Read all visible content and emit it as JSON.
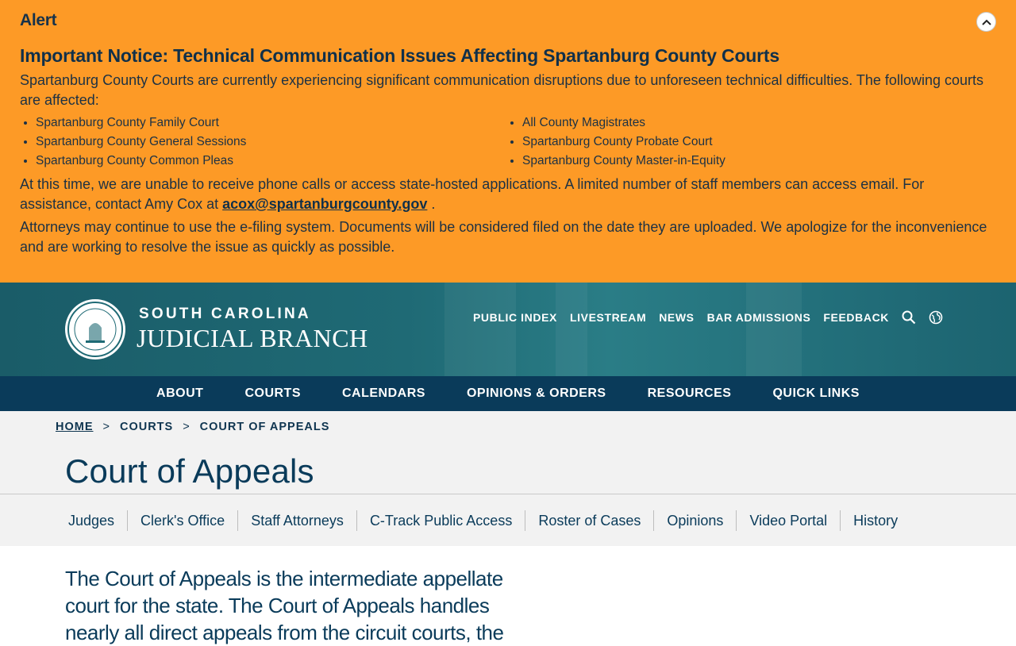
{
  "alert": {
    "heading": "Alert",
    "toggle_icon": "chevron-up-icon",
    "title": "Important Notice: Technical Communication Issues Affecting Spartanburg County Courts",
    "intro": "Spartanburg County Courts are currently experiencing significant communication disruptions due to unforeseen technical difficulties. The following courts are affected:",
    "courts_left": [
      "Spartanburg County Family Court",
      "Spartanburg County General Sessions",
      "Spartanburg County Common Pleas"
    ],
    "courts_right": [
      "All County Magistrates",
      "Spartanburg County Probate Court",
      "Spartanburg County Master-in-Equity"
    ],
    "contact_text": "At this time, we are unable to receive phone calls or access state-hosted applications. A limited number of staff members can access email. For assistance, contact Amy Cox at ",
    "contact_email": "acox@spartanburgcounty.gov",
    "contact_end": " .",
    "closing": "Attorneys may continue to use the e-filing system. Documents will be considered filed on the date they are uploaded. We apologize for the inconvenience and are working to resolve the issue as quickly as possible.",
    "background": "#fd9a26"
  },
  "header": {
    "brand_line1": "SOUTH CAROLINA",
    "brand_line2": "JUDICIAL BRANCH",
    "utility_links": [
      "PUBLIC INDEX",
      "LIVESTREAM",
      "NEWS",
      "BAR ADMISSIONS",
      "FEEDBACK"
    ],
    "icons": [
      "search-icon",
      "globe-icon"
    ]
  },
  "main_nav": [
    "ABOUT",
    "COURTS",
    "CALENDARS",
    "OPINIONS & ORDERS",
    "RESOURCES",
    "QUICK LINKS"
  ],
  "breadcrumb": {
    "home": "HOME",
    "sep": ">",
    "level1": "COURTS",
    "current": "COURT OF APPEALS"
  },
  "page": {
    "title": "Court of Appeals",
    "sub_nav": [
      "Judges",
      "Clerk's Office",
      "Staff Attorneys",
      "C-Track Public Access",
      "Roster of Cases",
      "Opinions",
      "Video Portal",
      "History"
    ],
    "intro": "The Court of Appeals is the intermediate appellate court for the state. The Court of Appeals handles nearly all direct appeals from the circuit courts, the"
  },
  "colors": {
    "navy": "#0a3b5a",
    "header_teal": "#1f6a75",
    "alert_orange": "#fd9a26"
  }
}
